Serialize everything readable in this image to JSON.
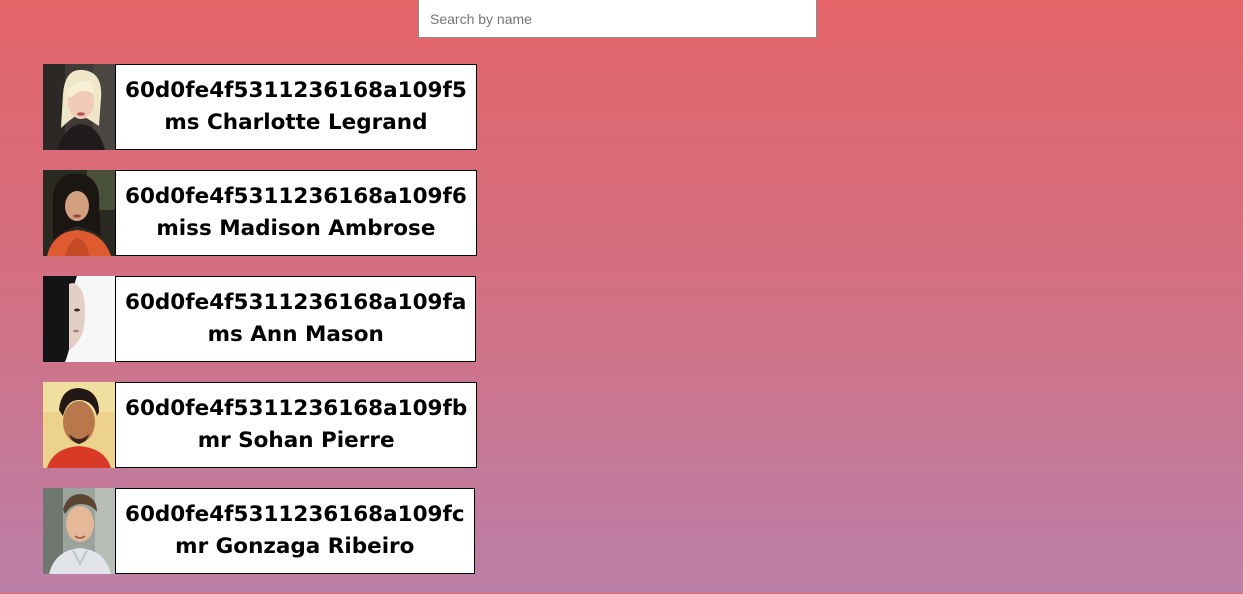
{
  "search": {
    "value": "",
    "placeholder": "Search by name"
  },
  "users": [
    {
      "id": "60d0fe4f5311236168a109f5",
      "name": "ms Charlotte Legrand"
    },
    {
      "id": "60d0fe4f5311236168a109f6",
      "name": "miss Madison Ambrose"
    },
    {
      "id": "60d0fe4f5311236168a109fa",
      "name": "ms Ann Mason"
    },
    {
      "id": "60d0fe4f5311236168a109fb",
      "name": "mr Sohan Pierre"
    },
    {
      "id": "60d0fe4f5311236168a109fc",
      "name": "mr Gonzaga Ribeiro"
    }
  ]
}
